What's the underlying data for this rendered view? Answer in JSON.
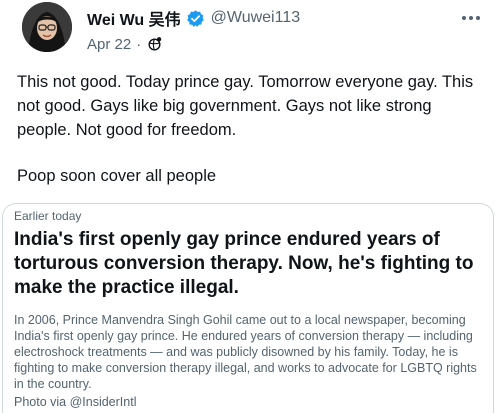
{
  "author": {
    "display_name": "Wei Wu 吴伟",
    "handle": "@Wuwei113",
    "avatar_icon": "profile-photo",
    "verified_icon": "verified-badge-icon",
    "verified_color": "#1d9bf0"
  },
  "meta": {
    "date": "Apr 22",
    "separator": "·",
    "audience_icon": "audience-icon"
  },
  "more_icon": "more-options-icon",
  "tweet": {
    "paragraph_1": "This not good. Today prince gay. Tomorrow everyone gay. This not good. Gays like big government. Gays not like strong people. Not good for freedom.",
    "paragraph_2": "Poop soon cover all people"
  },
  "card": {
    "label": "Earlier today",
    "headline": "India's first openly gay prince endured years of torturous conversion therapy. Now, he's fighting to make the practice illegal.",
    "body": "In 2006, Prince Manvendra Singh Gohil came out to a local newspaper, becoming India's first openly gay prince. He endured years of conversion therapy — including electroshock treatments — and was publicly disowned by his family. Today, he is fighting to make conversion therapy illegal, and works to advocate for LGBTQ rights in the country.",
    "credit": "Photo via @InsiderIntl"
  },
  "colors": {
    "text_primary": "#0f1419",
    "text_secondary": "#536471",
    "border": "#cfd9de"
  }
}
